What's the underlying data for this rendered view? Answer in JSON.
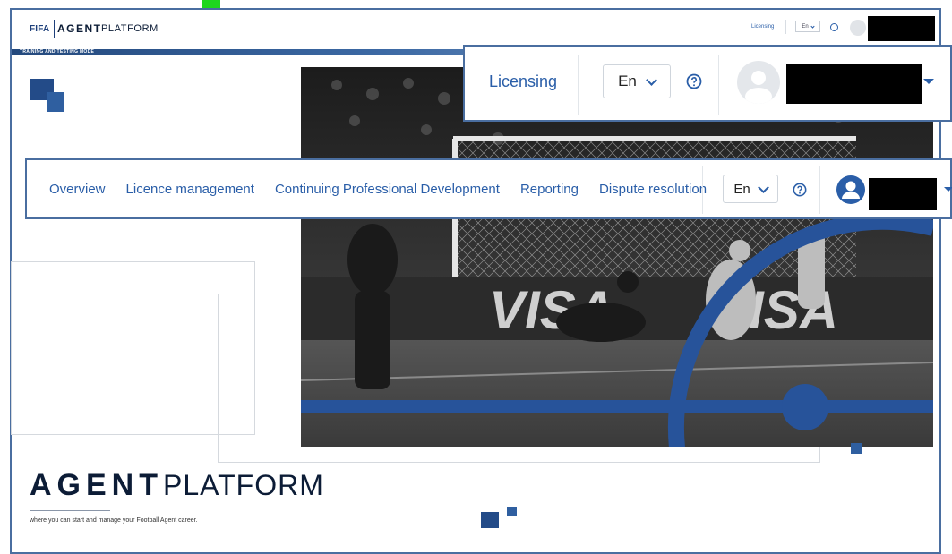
{
  "header": {
    "logo_fifa": "FIFA",
    "logo_agent": "AGENT",
    "logo_platform": "PLATFORM",
    "licensing": "Licensing",
    "language": "En",
    "mode_banner": "TRAINING AND TESTING MODE"
  },
  "callout_account": {
    "licensing": "Licensing",
    "language": "En"
  },
  "nav": {
    "items": [
      "Overview",
      "Licence management",
      "Continuing Professional Development",
      "Reporting",
      "Dispute resolution"
    ],
    "language": "En"
  },
  "hero": {
    "brand_agent": "AGENT",
    "brand_platform": "PLATFORM",
    "tagline": "where you can start and manage your Football Agent career.",
    "photo_ad_text": "VISA"
  },
  "colors": {
    "brand_blue": "#2a5ea8",
    "navy": "#0c1c36",
    "accent_square": "#234b88",
    "marker_green": "#1ed61e"
  },
  "icons": [
    "help-circle-icon",
    "user-avatar-icon",
    "chevron-down-icon",
    "caret-down-icon"
  ]
}
